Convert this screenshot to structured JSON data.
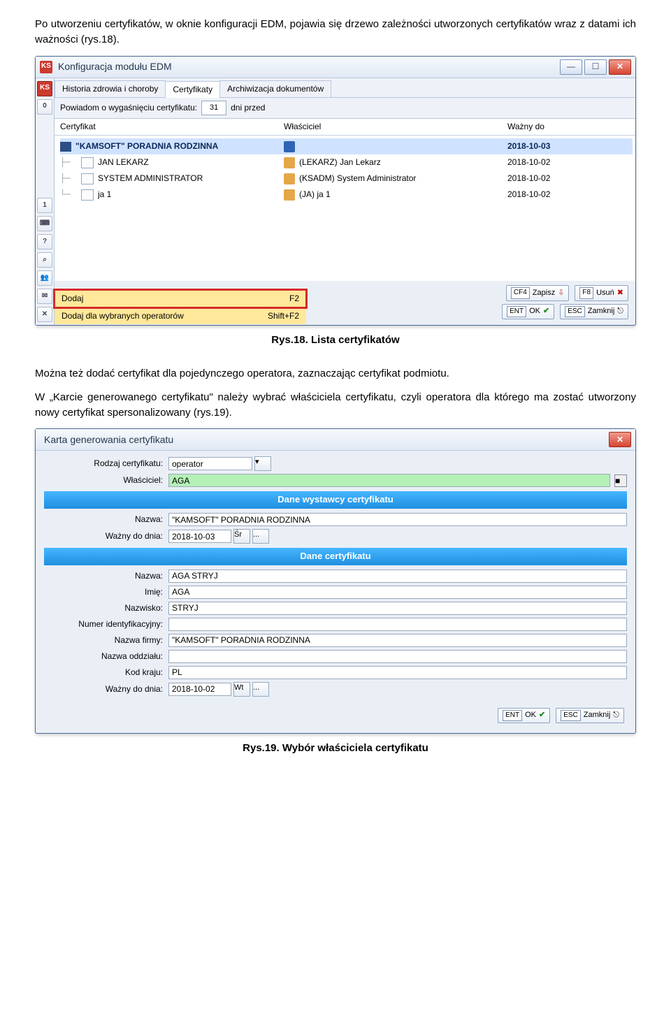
{
  "page": {
    "intro": "Po utworzeniu certyfikatów, w oknie konfiguracji EDM, pojawia się drzewo zależności utworzonych certyfikatów wraz z datami ich ważności (rys.18).",
    "caption18": "Rys.18. Lista certyfikatów",
    "mid1": "Można też dodać certyfikat dla pojedynczego operatora, zaznaczając certyfikat podmiotu.",
    "mid2": "W „Karcie generowanego certyfikatu\" należy wybrać właściciela certyfikatu, czyli operatora dla którego ma zostać utworzony nowy certyfikat spersonalizowany (rys.19).",
    "caption19": "Rys.19. Wybór właściciela certyfikatu"
  },
  "cfg": {
    "title": "Konfiguracja modułu EDM",
    "side": {
      "ks": "KS",
      "zero": "0",
      "one": "1",
      "calc": "⌨",
      "q": "?",
      "srch": "⌕",
      "people": "👥",
      "mail": "✉",
      "x": "✕"
    },
    "tabs": {
      "history": "Historia zdrowia i choroby",
      "certs": "Certyfikaty",
      "arch": "Archiwizacja dokumentów"
    },
    "notify_label": "Powiadom o wygaśnięciu certyfikatu:",
    "notify_value": "31",
    "notify_suffix": "dni przed",
    "cols": {
      "cert": "Certyfikat",
      "owner": "Właściciel",
      "valid": "Ważny do"
    },
    "rows": [
      {
        "name": "\"KAMSOFT\" PORADNIA RODZINNA",
        "owner": "",
        "date": "2018-10-03",
        "sel": true,
        "root": true
      },
      {
        "name": "JAN LEKARZ",
        "owner": "(LEKARZ) Jan Lekarz",
        "date": "2018-10-02"
      },
      {
        "name": "SYSTEM ADMINISTRATOR",
        "owner": "(KSADM) System Administrator",
        "date": "2018-10-02"
      },
      {
        "name": "ja 1",
        "owner": "(JA) ja 1",
        "date": "2018-10-02"
      }
    ],
    "ctx": {
      "add": "Dodaj",
      "add_key": "F2",
      "add_multi": "Dodaj dla wybranych operatorów",
      "add_multi_key": "Shift+F2"
    },
    "foot": {
      "save_k": "CF4",
      "save": "Zapisz",
      "del_k": "F8",
      "del": "Usuń",
      "ok_k": "ENT",
      "ok": "OK",
      "close_k": "ESC",
      "close": "Zamknij"
    }
  },
  "card": {
    "title": "Karta generowania certyfikatu",
    "labels": {
      "kind": "Rodzaj certyfikatu:",
      "owner": "Właściciel:",
      "issuer_header": "Dane wystawcy certyfikatu",
      "name": "Nazwa:",
      "valid_to": "Ważny do dnia:",
      "cert_header": "Dane certyfikatu",
      "first": "Imię:",
      "last": "Nazwisko:",
      "idnum": "Numer identyfikacyjny:",
      "company": "Nazwa firmy:",
      "dept": "Nazwa oddziału:",
      "country": "Kod kraju:"
    },
    "values": {
      "kind": "operator",
      "owner": "AGA",
      "issuer_name": "\"KAMSOFT\" PORADNIA RODZINNA",
      "issuer_valid": "2018-10-03",
      "issuer_dow": "Śr",
      "cert_name": "AGA STRYJ",
      "first": "AGA",
      "last": "STRYJ",
      "idnum": "",
      "company": "\"KAMSOFT\" PORADNIA RODZINNA",
      "dept": "",
      "country": "PL",
      "cert_valid": "2018-10-02",
      "cert_dow": "Wt",
      "dots": "..."
    },
    "foot": {
      "ok_k": "ENT",
      "ok": "OK",
      "close_k": "ESC",
      "close": "Zamknij"
    }
  }
}
